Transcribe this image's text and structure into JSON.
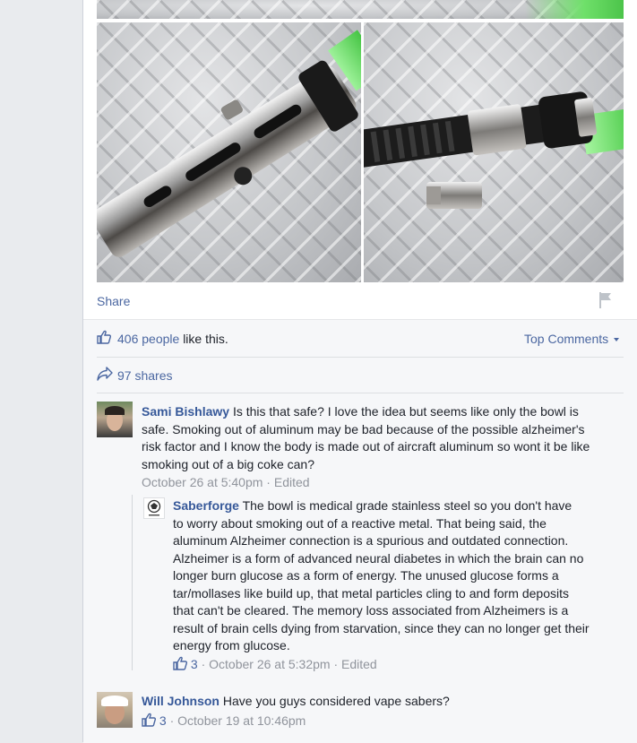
{
  "post": {
    "share_label": "Share",
    "likes_count": "406 people",
    "likes_suffix": "like this.",
    "top_comments": "Top Comments",
    "shares": "97 shares"
  },
  "comments": [
    {
      "author": "Sami Bishlawy",
      "lines": [
        "Is this that safe? I love the idea but seems like only the bowl is",
        "safe. Smoking out of aluminum may be bad because of the possible alzheimer's",
        "risk factor and I know the body is made out of aircraft aluminum so wont it be like",
        "smoking out of a big coke can?"
      ],
      "time": "October 26 at 5:40pm",
      "edited": "Edited"
    },
    {
      "author": "Will Johnson",
      "lines": [
        "Have you guys considered vape sabers?"
      ],
      "likes": "3",
      "time": "October 19 at 10:46pm"
    }
  ],
  "reply": {
    "author": "Saberforge",
    "lines": [
      "The bowl is medical grade stainless steel so you don't have",
      "to worry about smoking out of a reactive metal. That being said, the",
      "aluminum Alzheimer connection is a spurious and outdated connection.",
      "Alzheimer is a form of advanced neural diabetes in which the brain can no",
      "longer burn glucose as a form of energy. The unused glucose forms a",
      "tar/mollases like build up, that metal particles cling to and form deposits",
      "that can't be cleared. The memory loss associated from Alzheimers is a",
      "result of brain cells dying from starvation, since they can no longer get their",
      "energy from glucose."
    ],
    "likes": "3",
    "time": "October 26 at 5:32pm",
    "edited": "Edited"
  },
  "colors": {
    "link": "#365899",
    "muted": "#90949c",
    "saber_green": "#5fd15a"
  }
}
